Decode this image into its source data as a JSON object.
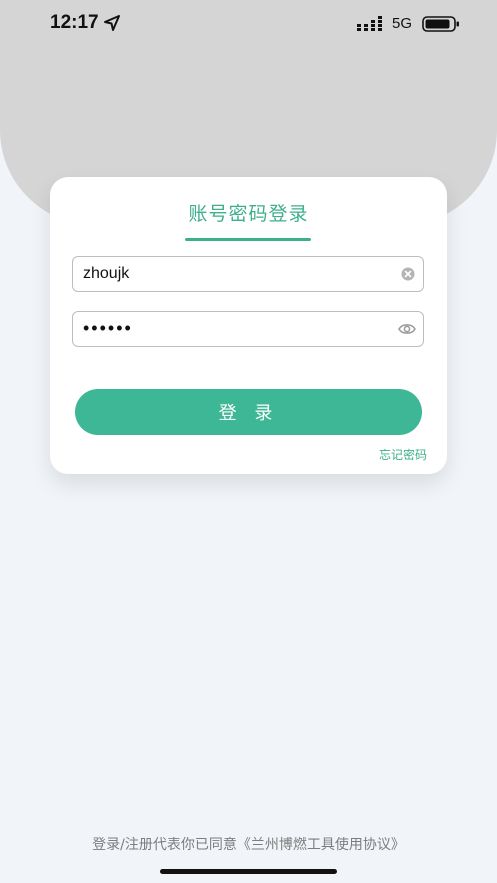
{
  "status_bar": {
    "time": "12:17",
    "network": "5G"
  },
  "login_card": {
    "title": "账号密码登录",
    "username_value": "zhoujk",
    "password_value": "••••••",
    "login_button_label": "登 录",
    "forgot_password_label": "忘记密码"
  },
  "footer": {
    "agreement_text": "登录/注册代表你已同意《兰州博燃工具使用协议》"
  },
  "colors": {
    "accent": "#3eaf8c",
    "button": "#3db795",
    "header_bg": "#d5d5d5",
    "page_bg": "#f1f4f9"
  },
  "icons": [
    "location-arrow-icon",
    "signal-icon",
    "battery-icon",
    "clear-icon",
    "eye-icon"
  ]
}
